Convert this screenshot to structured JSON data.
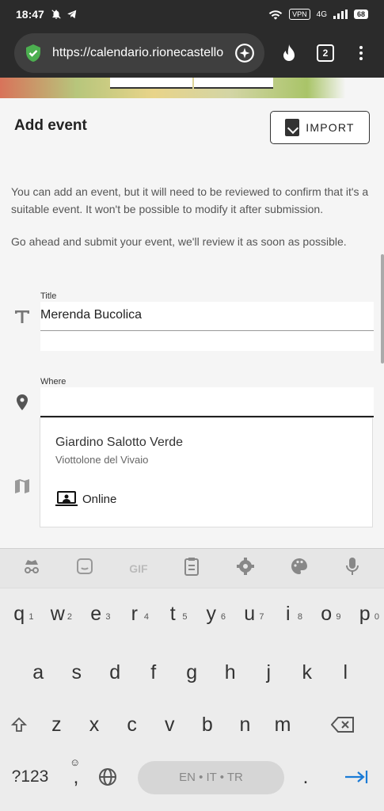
{
  "status_bar": {
    "time": "18:47",
    "vpn": "VPN",
    "network": "4G",
    "battery": "68"
  },
  "browser": {
    "url": "https://calendario.rionecastello",
    "tab_count": "2"
  },
  "page": {
    "title": "Add event",
    "import_label": "IMPORT",
    "description_1": "You can add an event, but it will need to be reviewed to confirm that it's a suitable event. It won't be possible to modify it after submission.",
    "description_2": "Go ahead and submit your event, we'll review it as soon as possible."
  },
  "form": {
    "title_label": "Title",
    "title_value": "Merenda Bucolica",
    "where_label": "Where",
    "where_value": ""
  },
  "suggestions": {
    "place_name": "Giardino Salotto Verde",
    "place_address": "Viottolone del Vivaio",
    "online_label": "Online"
  },
  "keyboard": {
    "row1": [
      "q",
      "w",
      "e",
      "r",
      "t",
      "y",
      "u",
      "i",
      "o",
      "p"
    ],
    "row1_numbers": [
      "1",
      "2",
      "3",
      "4",
      "5",
      "6",
      "7",
      "8",
      "9",
      "0"
    ],
    "row2": [
      "a",
      "s",
      "d",
      "f",
      "g",
      "h",
      "j",
      "k",
      "l"
    ],
    "row3": [
      "z",
      "x",
      "c",
      "v",
      "b",
      "n",
      "m"
    ],
    "symbols_key": "?123",
    "comma_key": ",",
    "period_key": ".",
    "space_label": "EN • IT • TR",
    "toolbar_gif": "GIF"
  }
}
